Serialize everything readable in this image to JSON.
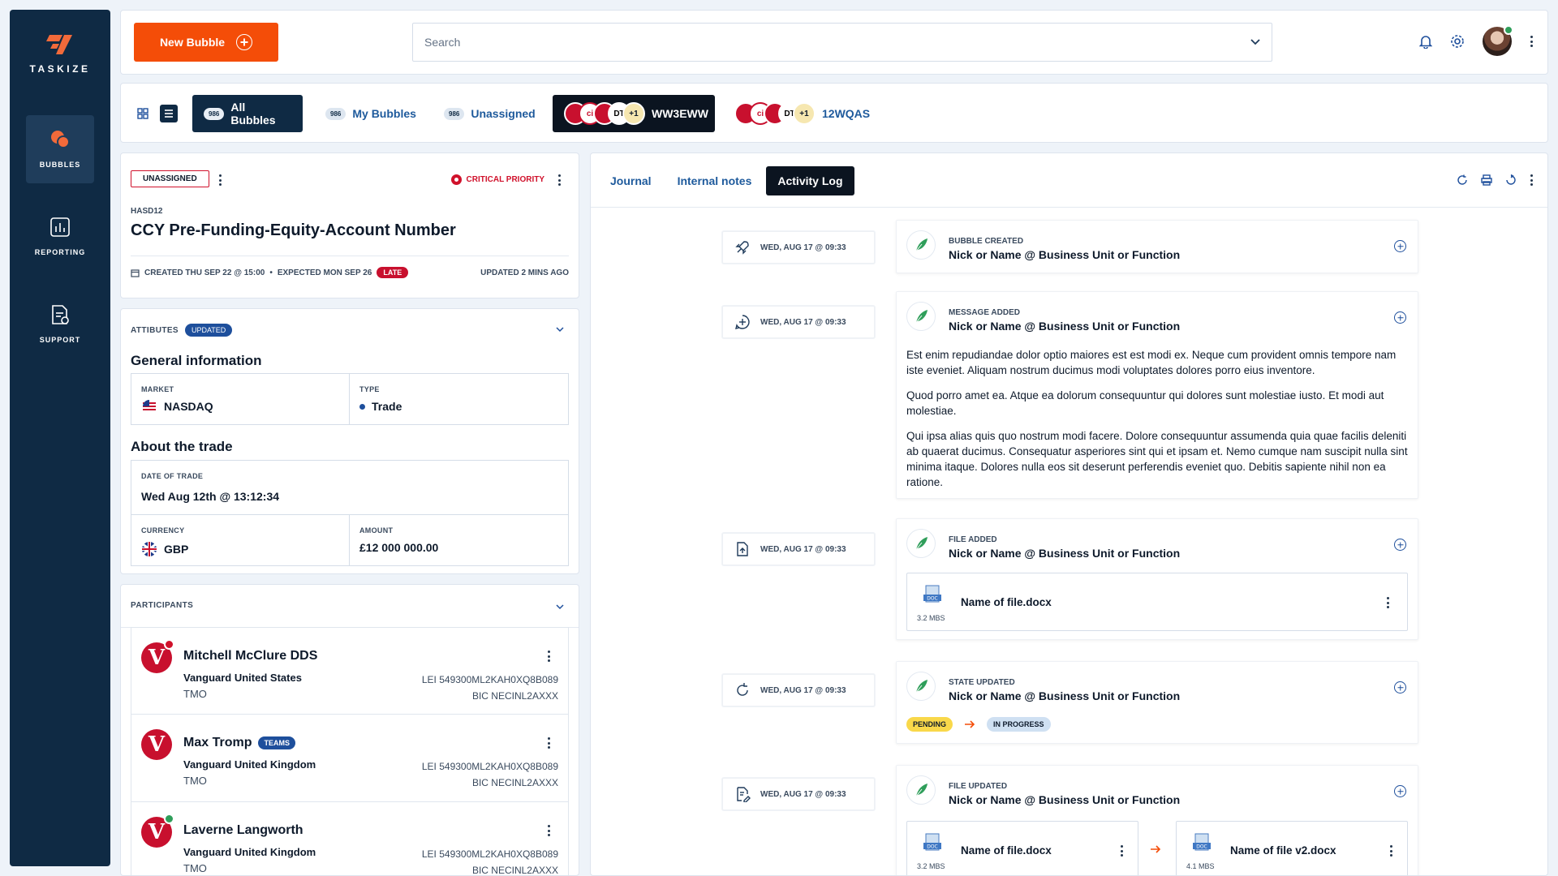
{
  "brand": {
    "name": "TASKIZE"
  },
  "nav": [
    {
      "label": "BUBBLES",
      "active": true
    },
    {
      "label": "REPORTING",
      "active": false
    },
    {
      "label": "SUPPORT",
      "active": false
    }
  ],
  "top": {
    "new_bubble": "New Bubble",
    "search_placeholder": "Search"
  },
  "tabs": {
    "all": {
      "label": "All Bubbles",
      "count": "986"
    },
    "mine": {
      "label": "My Bubbles",
      "count": "986"
    },
    "unassigned": {
      "label": "Unassigned",
      "count": "986"
    },
    "group1": {
      "label": "WW3EWW",
      "extra": "+1",
      "ci": "ci",
      "dt": "DT"
    },
    "group2": {
      "label": "12WQAS",
      "extra": "+1",
      "ci": "ci",
      "dt": "DT"
    }
  },
  "bubble": {
    "status": "UNASSIGNED",
    "priority": "CRITICAL PRIORITY",
    "id": "HASD12",
    "title": "CCY Pre-Funding-Equity-Account Number",
    "created": "CREATED THU SEP 22 @ 15:00",
    "expected": "EXPECTED MON SEP 26",
    "late": "LATE",
    "updated": "UPDATED  2 MINS AGO"
  },
  "attributes": {
    "heading": "ATTIBUTES",
    "updated_badge": "UPDATED",
    "general_title": "General information",
    "market_label": "MARKET",
    "market_value": "NASDAQ",
    "type_label": "TYPE",
    "type_value": "Trade",
    "trade_title": "About the trade",
    "date_label": "DATE OF TRADE",
    "date_value": "Wed Aug 12th @ 13:12:34",
    "currency_label": "CURRENCY",
    "currency_value": "GBP",
    "amount_label": "AMOUNT",
    "amount_value": "£12 000 000.00"
  },
  "participants": {
    "heading": "PARTICIPANTS",
    "items": [
      {
        "name": "Mitchell McClure DDS",
        "org": "Vanguard United States",
        "role": "TMO",
        "lei": "LEI 549300ML2KAH0XQ8B089",
        "bic": "BIC NECINL2AXXX",
        "status": "#d0112b",
        "badge": ""
      },
      {
        "name": "Max Tromp",
        "org": "Vanguard United Kingdom",
        "role": "TMO",
        "lei": "LEI 549300ML2KAH0XQ8B089",
        "bic": "BIC NECINL2AXXX",
        "status": "",
        "badge": "TEAMS"
      },
      {
        "name": "Laverne Langworth",
        "org": "Vanguard United Kingdom",
        "role": "TMO",
        "lei": "LEI 549300ML2KAH0XQ8B089",
        "bic": "BIC NECINL2AXXX",
        "status": "#2f9e5a",
        "badge": ""
      }
    ]
  },
  "activity": {
    "tabs": [
      "Journal",
      "Internal notes",
      "Activity Log"
    ],
    "active_tab": "Activity Log",
    "events": [
      {
        "date": "WED, AUG 17 @ 09:33",
        "type": "BUBBLE CREATED",
        "who": "Nick or Name @ Business Unit or Function",
        "icon": "rocket-icon"
      },
      {
        "date": "WED, AUG 17 @ 09:33",
        "type": "MESSAGE ADDED",
        "who": "Nick or Name @ Business Unit or Function",
        "icon": "message-plus-icon",
        "paragraphs": [
          "Est enim repudiandae dolor optio maiores est est modi ex. Neque cum provident omnis tempore nam iste eveniet. Aliquam nostrum ducimus modi voluptates dolores porro eius inventore.",
          "Quod porro amet ea. Atque ea dolorum consequuntur qui dolores sunt molestiae iusto. Et modi aut molestiae.",
          "Qui ipsa alias quis quo nostrum modi facere. Dolore consequuntur assumenda quia quae facilis deleniti ab quaerat ducimus. Consequatur asperiores sint qui et ipsam et. Nemo cumque nam suscipit nulla sint minima itaque. Dolores nulla eos sit deserunt perferendis eveniet quo. Debitis sapiente nihil non ea ratione."
        ]
      },
      {
        "date": "WED, AUG 17 @ 09:33",
        "type": "FILE ADDED",
        "who": "Nick or Name @ Business Unit or Function",
        "icon": "file-upload-icon",
        "file": {
          "name": "Name of file.docx",
          "size": "3.2 MBS",
          "ext": "DOC"
        }
      },
      {
        "date": "WED, AUG 17 @ 09:33",
        "type": "STATE UPDATED",
        "who": "Nick or Name @ Business Unit or Function",
        "icon": "refresh-icon",
        "from": "PENDING",
        "to": "IN PROGRESS"
      },
      {
        "date": "WED, AUG 17 @ 09:33",
        "type": "FILE UPDATED",
        "who": "Nick or Name @ Business Unit or Function",
        "icon": "file-edit-icon",
        "file_old": {
          "name": "Name of file.docx",
          "size": "3.2 MBS",
          "ext": "DOC"
        },
        "file_new": {
          "name": "Name of file v2.docx",
          "size": "4.1 MBS",
          "ext": "DOC"
        }
      }
    ]
  },
  "colors": {
    "accent": "#f44d08",
    "navy": "#0f2a44",
    "link": "#1e5a9c",
    "critical": "#d0112b",
    "success": "#2f9e5a"
  }
}
